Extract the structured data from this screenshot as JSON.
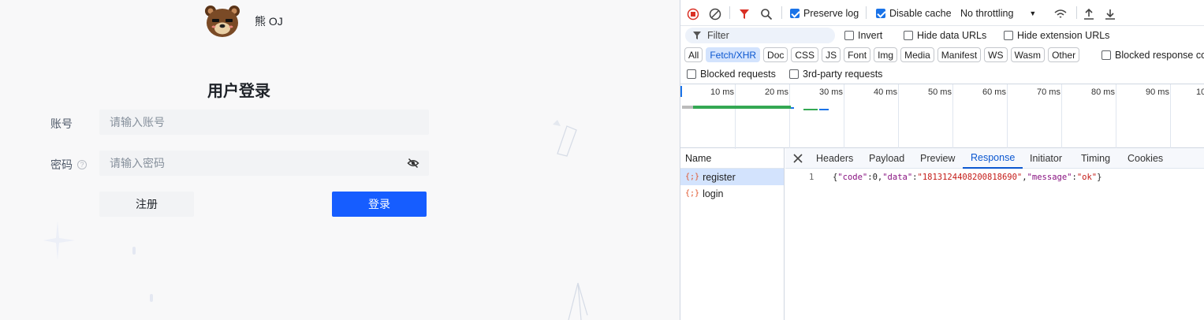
{
  "app": {
    "brand": "熊 OJ",
    "title": "用户登录",
    "account_label": "账号",
    "account_placeholder": "请输入账号",
    "password_label": "密码",
    "password_help": "?",
    "password_placeholder": "请输入密码",
    "register_button": "注册",
    "login_button": "登录",
    "accent_color": "#165dff"
  },
  "devtools": {
    "toolbar": {
      "preserve_log": "Preserve log",
      "disable_cache": "Disable cache",
      "throttling": "No throttling",
      "preserve_log_checked": true,
      "disable_cache_checked": true
    },
    "filter": {
      "placeholder": "Filter",
      "invert": "Invert",
      "hide_data_urls": "Hide data URLs",
      "hide_extension_urls": "Hide extension URLs"
    },
    "chips": [
      "All",
      "Fetch/XHR",
      "Doc",
      "CSS",
      "JS",
      "Font",
      "Img",
      "Media",
      "Manifest",
      "WS",
      "Wasm",
      "Other"
    ],
    "selected_chip": "Fetch/XHR",
    "blocked_response": "Blocked response co",
    "blocked_requests": "Blocked requests",
    "third_party": "3rd-party requests",
    "timeline_ticks": [
      "10 ms",
      "20 ms",
      "30 ms",
      "40 ms",
      "50 ms",
      "60 ms",
      "70 ms",
      "80 ms",
      "90 ms",
      "10"
    ],
    "name_header": "Name",
    "requests": [
      {
        "name": "register",
        "selected": true
      },
      {
        "name": "login",
        "selected": false
      }
    ],
    "tabs": [
      "Headers",
      "Payload",
      "Preview",
      "Response",
      "Initiator",
      "Timing",
      "Cookies"
    ],
    "active_tab": "Response",
    "response": {
      "line_number": "1",
      "p1": "{",
      "k1": "\"code\"",
      "c1": ":0,",
      "k2": "\"data\"",
      "c2": ":",
      "v2": "\"1813124408200818690\"",
      "c3": ",",
      "k3": "\"message\"",
      "c4": ":",
      "v3": "\"ok\"",
      "p2": "}"
    }
  }
}
